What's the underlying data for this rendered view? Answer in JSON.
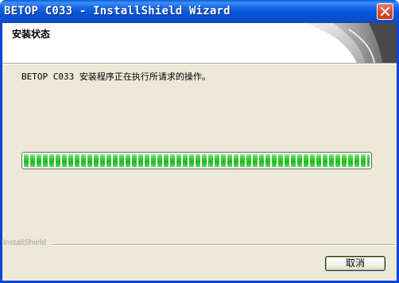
{
  "window": {
    "title": "BETOP C033 - InstallShield Wizard"
  },
  "header": {
    "title": "安装状态"
  },
  "main": {
    "status_text": "BETOP C033 安装程序正在执行所请求的操作。",
    "progress_fraction": 1.0
  },
  "footer": {
    "brand": "InstallShield",
    "cancel_label": "取消"
  },
  "icons": {
    "close": "close-icon",
    "header_graphic": "installshield-swirl-graphic"
  },
  "colors": {
    "titlebar": "#0552d6",
    "dialog_background": "#ece9d8",
    "progress_green": "#22b822",
    "close_button": "#d9532e"
  }
}
